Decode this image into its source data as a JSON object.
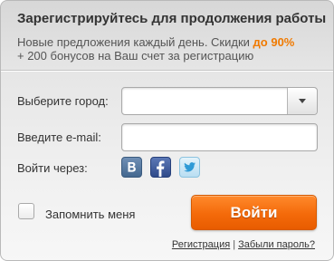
{
  "header": {
    "title": "Зарегистрируйтесь для продолжения работы",
    "subtitle_line1_prefix": "Новые предложения каждый день. Скидки ",
    "subtitle_highlight": "до 90%",
    "subtitle_line2": "+ 200 бонусов на Ваш счет за регистрацию"
  },
  "form": {
    "city_label": "Выберите город:",
    "city_value": "",
    "email_label": "Введите e-mail:",
    "email_value": "",
    "email_placeholder": "",
    "social_label": "Войти через:",
    "social_icons": [
      "vkontakte-icon",
      "facebook-icon",
      "twitter-icon"
    ],
    "remember_label": "Запомнить меня",
    "remember_checked": false,
    "submit_label": "Войти"
  },
  "links": {
    "register": "Регистрация",
    "separator": "|",
    "forgot_password": "Забыли пароль?"
  },
  "colors": {
    "accent": "#f46a0a",
    "highlight_text": "#f07a00",
    "vk": "#44688f",
    "facebook": "#3b5998",
    "twitter": "#55acee"
  }
}
